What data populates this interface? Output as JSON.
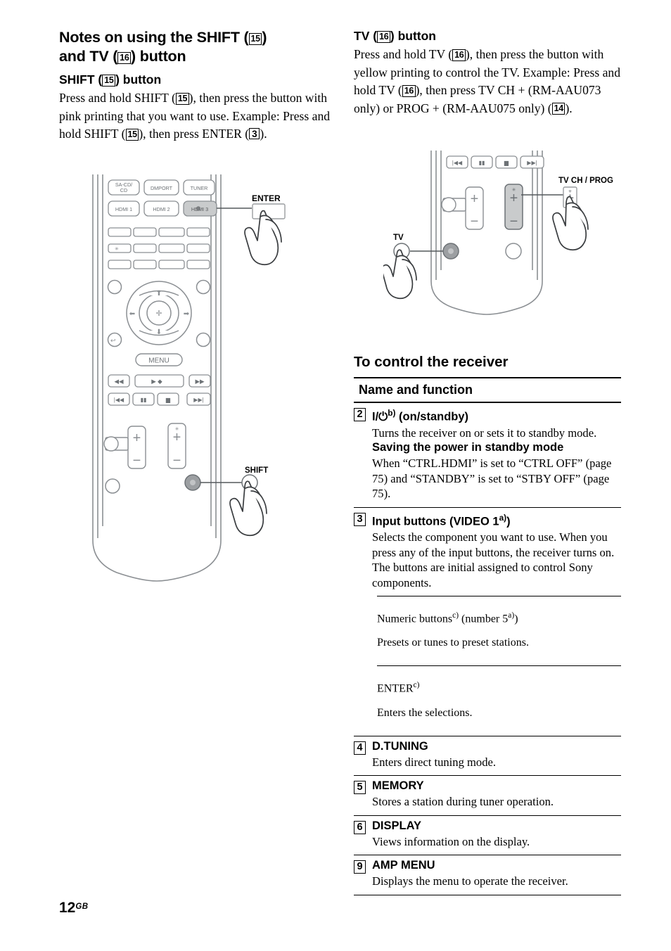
{
  "page": {
    "number": "12",
    "region_suffix": "GB"
  },
  "left_column": {
    "section_heading_parts": {
      "line1_pre": "Notes on using the SHIFT (",
      "line1_ref": "15",
      "line1_post": ") ",
      "line2_pre": "and TV (",
      "line2_ref": "16",
      "line2_post": ") button"
    },
    "subheading": {
      "pre": "SHIFT (",
      "ref": "15",
      "post": ") button"
    },
    "paragraph": {
      "p1_a": "Press and hold SHIFT (",
      "p1_ref1": "15",
      "p1_b": "), then press the button with pink printing that you want to use. Example: Press and hold SHIFT (",
      "p1_ref2": "15",
      "p1_c": "), then press ENTER (",
      "p1_ref3": "3",
      "p1_d": ")."
    },
    "figure": {
      "name": "remote-control-shift-illustration",
      "callout_enter": "ENTER",
      "callout_shift": "SHIFT",
      "buttons": [
        "SA-CD/ CD",
        "DMPORT",
        "TUNER",
        "HDMI 1",
        "HDMI 2",
        "HDMI 3"
      ],
      "highlighted_button": "HDMI 3",
      "menu_label": "MENU"
    }
  },
  "right_column": {
    "subheading": {
      "pre": "TV (",
      "ref": "16",
      "post": ") button"
    },
    "paragraph": {
      "p1_a": "Press and hold TV (",
      "p1_ref1": "16",
      "p1_b": "), then press the button with yellow printing to control the TV. Example: Press and hold TV (",
      "p1_ref2": "16",
      "p1_c": "), then press TV CH + (RM-AAU073 only) or PROG + (RM-AAU075 only) (",
      "p1_ref3": "14",
      "p1_d": ")."
    },
    "figure": {
      "name": "remote-control-tv-illustration",
      "callout_tv": "TV",
      "callout_tvch": "TV CH / PROG"
    },
    "table_heading": "To control the receiver",
    "table_column_header": "Name and function",
    "rows": [
      {
        "num": "2",
        "name_pre": "I/",
        "name_symbol": "⏻",
        "name_sup": "b)",
        "name_post": " (on/standby)",
        "desc": "Turns the receiver on or sets it to standby mode.",
        "sub_bold": "Saving the power in standby mode",
        "sub_desc": "When “CTRL.HDMI” is set to “CTRL OFF” (page 75) and “STANDBY” is set to “STBY OFF” (page 75)."
      },
      {
        "num": "3",
        "name_pre": "Input buttons (VIDEO 1",
        "name_sup": "a)",
        "name_post": ")",
        "desc": "Selects the component you want to use. When you press any of the input buttons, the receiver turns on. The buttons are initial assigned to control Sony components.",
        "subitems": [
          {
            "name_pre": "Numeric buttons",
            "name_sup": "c)",
            "name_mid": " (number 5",
            "name_sup2": "a)",
            "name_post": ")",
            "desc": "Presets or tunes to preset stations."
          },
          {
            "name_pre": "ENTER",
            "name_sup": "c)",
            "name_post": "",
            "desc": "Enters the selections."
          }
        ]
      },
      {
        "num": "4",
        "name_pre": "D.TUNING",
        "desc": "Enters direct tuning mode."
      },
      {
        "num": "5",
        "name_pre": "MEMORY",
        "desc": "Stores a station during tuner operation."
      },
      {
        "num": "6",
        "name_pre": "DISPLAY",
        "desc": "Views information on the display."
      },
      {
        "num": "9",
        "name_pre": "AMP MENU",
        "desc": "Displays the menu to operate the receiver."
      }
    ]
  }
}
